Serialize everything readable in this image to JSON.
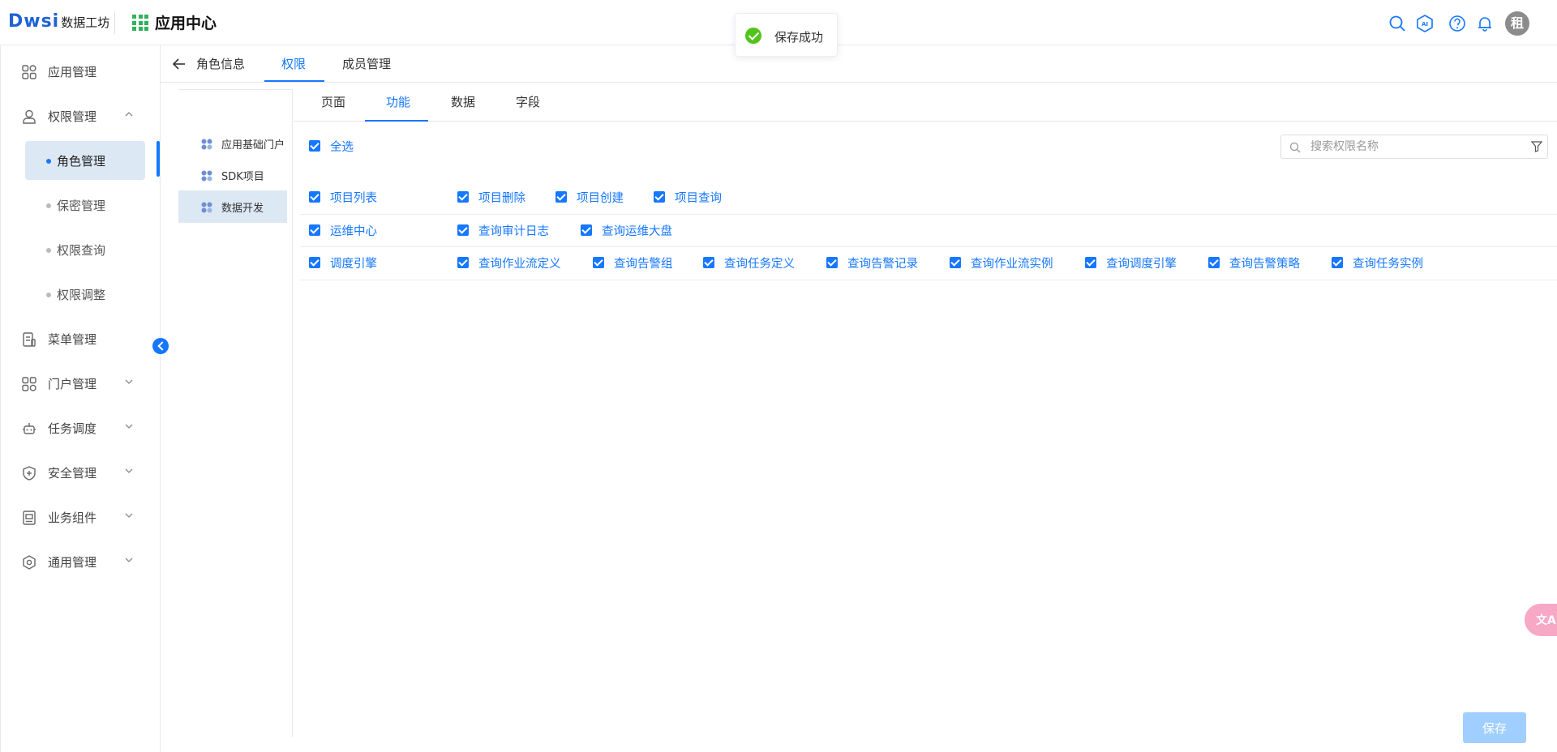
{
  "header": {
    "brand": "Dwsi",
    "brand_sub": "数据工坊",
    "app_title": "应用中心",
    "avatar_text": "租",
    "icons": [
      "search-icon",
      "ai-icon",
      "help-icon",
      "bell-icon"
    ]
  },
  "toast": {
    "message": "保存成功",
    "color": "#52c41a"
  },
  "sidebar": {
    "items": [
      {
        "label": "应用管理",
        "icon": "apps-icon"
      },
      {
        "label": "权限管理",
        "icon": "user-icon",
        "expanded": true
      },
      {
        "label": "菜单管理",
        "icon": "menu-doc-icon"
      },
      {
        "label": "门户管理",
        "icon": "portal-icon"
      },
      {
        "label": "任务调度",
        "icon": "robot-icon"
      },
      {
        "label": "安全管理",
        "icon": "shield-icon"
      },
      {
        "label": "业务组件",
        "icon": "component-icon"
      },
      {
        "label": "通用管理",
        "icon": "settings-icon"
      }
    ],
    "sub_items": [
      {
        "label": "角色管理",
        "active": true
      },
      {
        "label": "保密管理"
      },
      {
        "label": "权限查询"
      },
      {
        "label": "权限调整"
      }
    ]
  },
  "role_tabs": {
    "back_label": "角色信息",
    "tabs": [
      "权限",
      "成员管理"
    ],
    "active": "权限"
  },
  "projects": [
    {
      "label": "应用基础门户"
    },
    {
      "label": "SDK项目"
    },
    {
      "label": "数据开发",
      "active": true
    }
  ],
  "perm_tabs": {
    "tabs": [
      "页面",
      "功能",
      "数据",
      "字段"
    ],
    "active": "功能"
  },
  "select_all": "全选",
  "search": {
    "placeholder": "搜索权限名称",
    "value": ""
  },
  "groups": [
    {
      "name": "项目列表",
      "perms": [
        "项目删除",
        "项目创建",
        "项目查询"
      ]
    },
    {
      "name": "运维中心",
      "perms": [
        "查询审计日志",
        "查询运维大盘"
      ]
    },
    {
      "name": "调度引擎",
      "perms": [
        "查询作业流定义",
        "查询告警组",
        "查询任务定义",
        "查询告警记录",
        "查询作业流实例",
        "查询调度引擎",
        "查询告警策略",
        "查询任务实例"
      ]
    }
  ],
  "save_label": "保存",
  "translate_label": "文A",
  "colors": {
    "accent": "#1677ff",
    "active_bg": "#dde8f5",
    "save_disabled": "#a0cfff"
  }
}
